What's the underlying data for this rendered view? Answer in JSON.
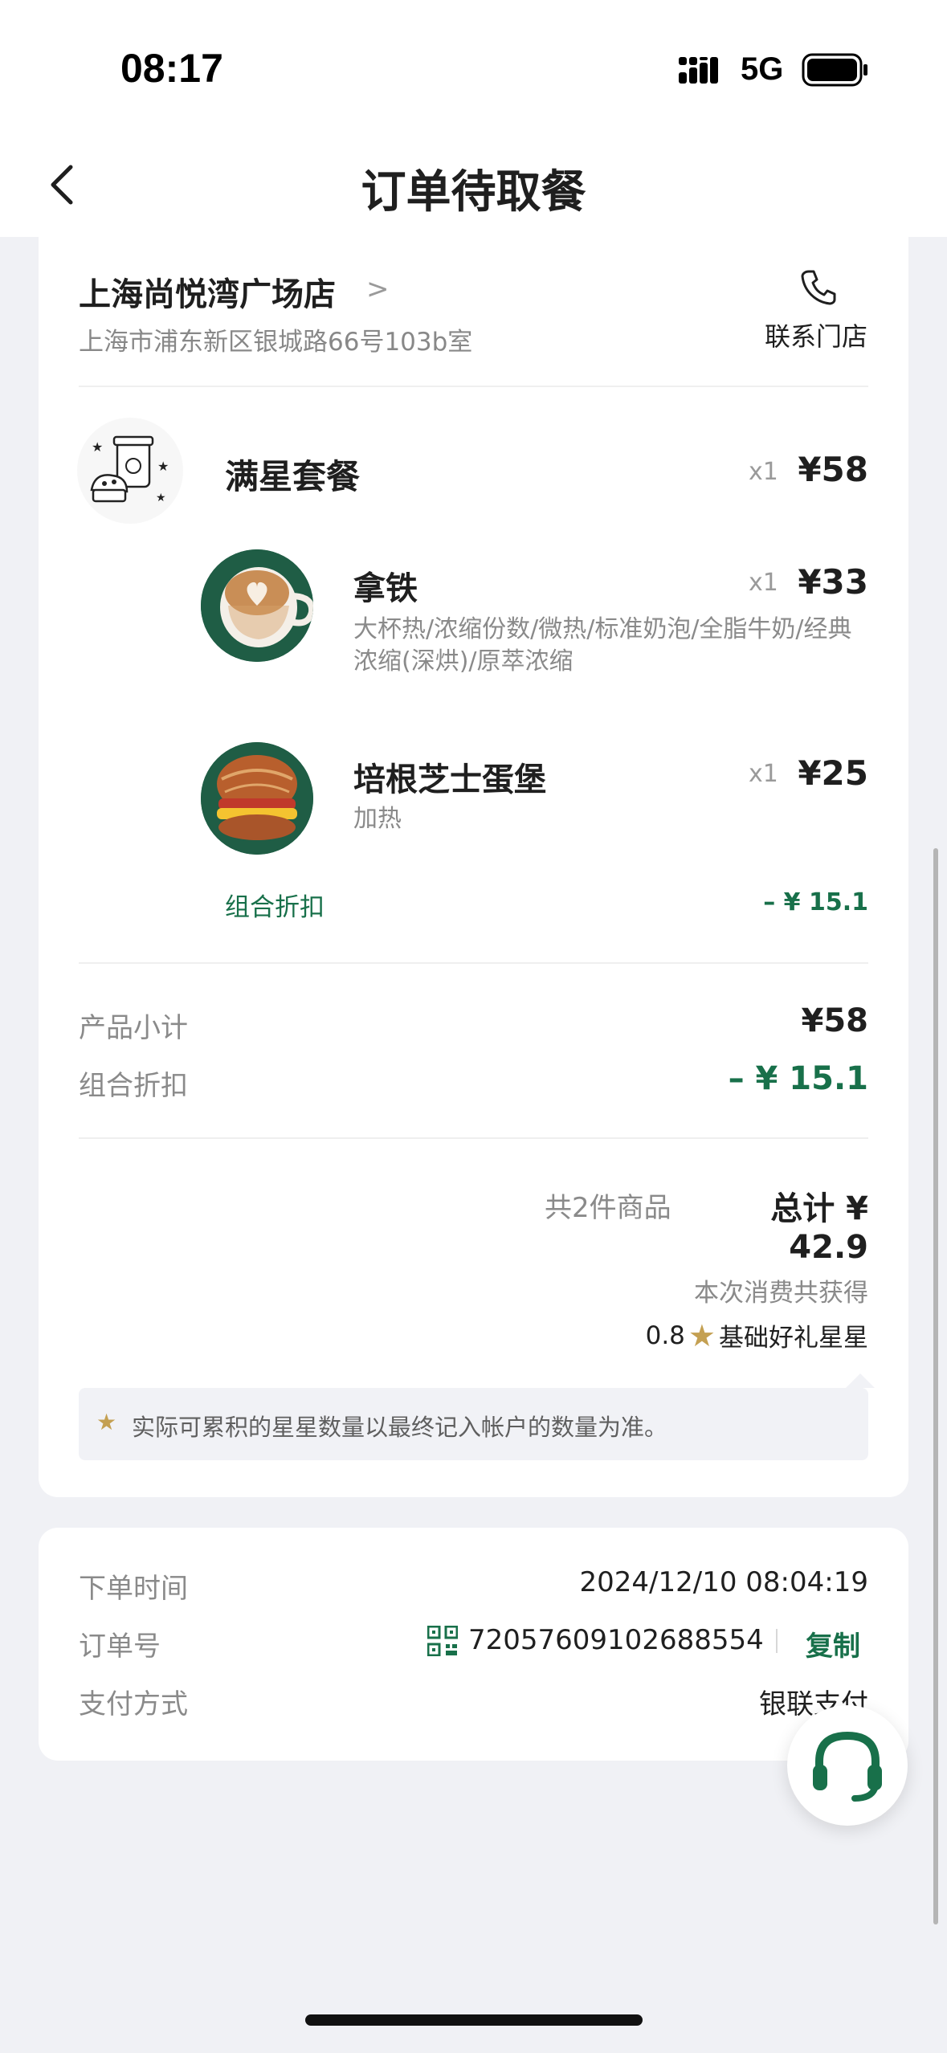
{
  "status_bar": {
    "time": "08:17",
    "network": "5G"
  },
  "nav": {
    "title": "订单待取餐"
  },
  "store": {
    "name": "上海尚悦湾广场店",
    "chevron": ">",
    "address": "上海市浦东新区银城路66号103b室",
    "contact_label": "联系门店"
  },
  "package": {
    "name": "满星套餐",
    "qty": "x1",
    "price": "¥58",
    "items": [
      {
        "name": "拿铁",
        "qty": "x1",
        "price": "¥33",
        "spec": "大杯热/浓缩份数/微热/标准奶泡/全脂牛奶/经典浓缩(深烘)/原萃浓缩"
      },
      {
        "name": "培根芝士蛋堡",
        "qty": "x1",
        "price": "¥25",
        "spec": "加热"
      }
    ],
    "discount_label": "组合折扣",
    "discount_value": "– ¥ 15.1"
  },
  "summary": {
    "subtotal_label": "产品小计",
    "subtotal_value": "¥58",
    "discount_label": "组合折扣",
    "discount_value": "– ¥ 15.1",
    "count_text": "共2件商品",
    "total_text": "总计 ¥ 42.9"
  },
  "rewards": {
    "earned_label": "本次消费共获得",
    "stars_amount": "0.8",
    "stars_label": "基础好礼星星",
    "note": "实际可累积的星星数量以最终记入帐户的数量为准。"
  },
  "order_info": {
    "time_label": "下单时间",
    "time_value": "2024/12/10 08:04:19",
    "number_label": "订单号",
    "number_value": "72057609102688554",
    "copy_label": "复制",
    "payment_label": "支付方式",
    "payment_value": "银联支付"
  },
  "colors": {
    "accent_green": "#18704a",
    "star_gold": "#c4a052",
    "background": "#f0f1f5"
  }
}
